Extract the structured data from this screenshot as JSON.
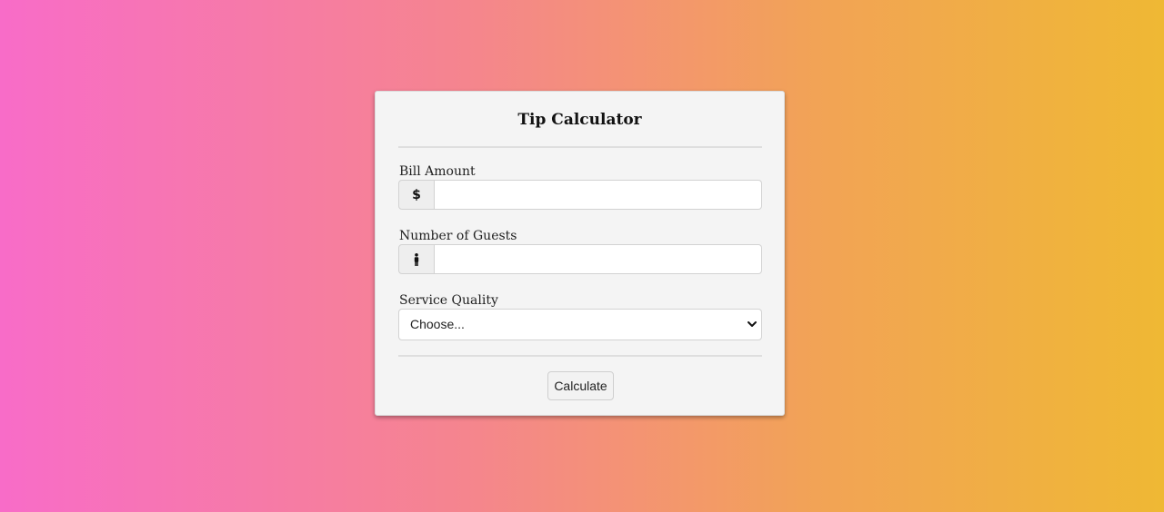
{
  "calculator": {
    "title": "Tip Calculator",
    "bill": {
      "label": "Bill Amount",
      "addon": "$",
      "value": ""
    },
    "guests": {
      "label": "Number of Guests",
      "addon_icon": "person-icon",
      "value": ""
    },
    "service": {
      "label": "Service Quality",
      "selected": "Choose..."
    },
    "calculate_label": "Calculate"
  }
}
